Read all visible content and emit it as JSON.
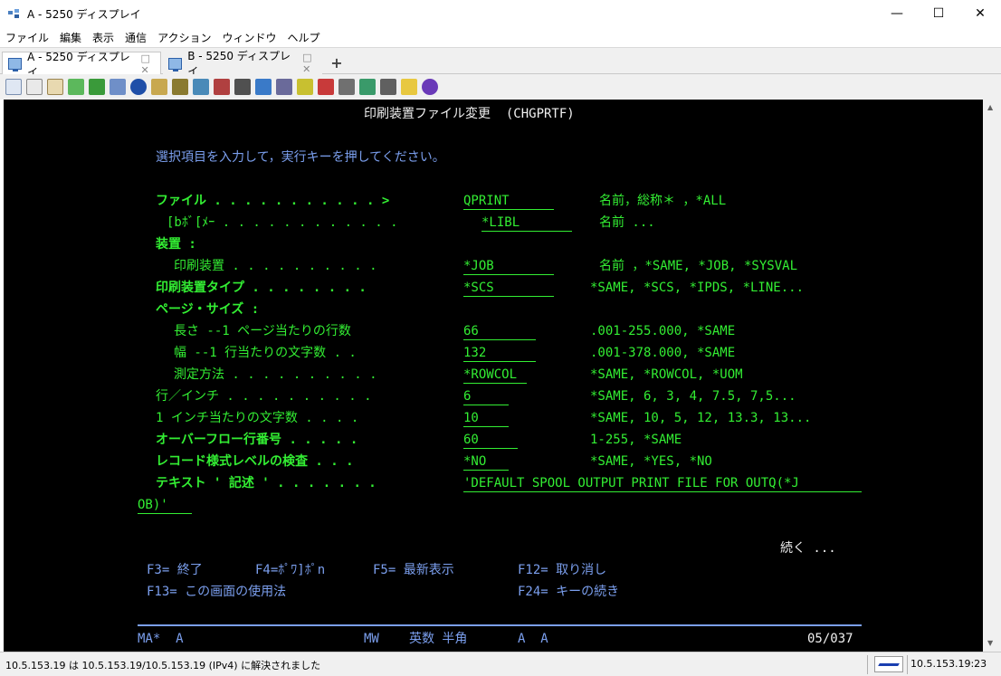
{
  "window": {
    "title": "A - 5250 ディスプレイ",
    "minimize": "—",
    "maximize": "☐",
    "close": "✕"
  },
  "menu": [
    "ファイル",
    "編集",
    "表示",
    "通信",
    "アクション",
    "ウィンドウ",
    "ヘルプ"
  ],
  "tabs": [
    {
      "label": "A - 5250 ディスプレイ",
      "active": true
    },
    {
      "label": "B - 5250 ディスプレイ",
      "active": false
    }
  ],
  "tab_controls": "□ ✕",
  "new_tab": "+",
  "toolbar_icons": [
    "copy-icon",
    "cut-icon",
    "paste-icon",
    "send-file-icon",
    "receive-file-icon",
    "macro-icon",
    "navigate-icon",
    "properties-icon",
    "print-screen-icon",
    "keypad-icon",
    "display-settings-icon",
    "session-icon",
    "color-map-icon",
    "grid-icon",
    "trace-icon",
    "disconnect-icon",
    "record-icon",
    "play-icon",
    "stop-icon",
    "notes-icon",
    "help-icon"
  ],
  "screen": {
    "title": "印刷装置ファイル変更  (CHGPRTF)",
    "instruction": "選択項目を入力して，実行キーを押してください。",
    "rows": [
      {
        "label": "ファイル . . . . . . . . . . . >",
        "value": "QPRINT",
        "hint": "名前，総称＊ ，*ALL",
        "bold": true
      },
      {
        "label": "[bﾎﾞ[ﾒｰ . . . . . . . . . . . .",
        "value": "*LIBL",
        "hint": "名前 ...",
        "bold": false
      },
      {
        "label": "装置 :",
        "value": "",
        "hint": "",
        "bold": true
      },
      {
        "label": "印刷装置 . . . . . . . . . .",
        "value": "*JOB",
        "hint": "名前 ，*SAME, *JOB, *SYSVAL",
        "bold": false
      },
      {
        "label": "印刷装置タイプ . . . . . . . .",
        "value": "*SCS",
        "hint": "*SAME, *SCS, *IPDS, *LINE...",
        "bold": true
      },
      {
        "label": "ページ・サイズ :",
        "value": "",
        "hint": "",
        "bold": true
      },
      {
        "label": "長さ --1 ページ当たりの行数",
        "value": "66",
        "hint": ".001-255.000, *SAME",
        "bold": false
      },
      {
        "label": "幅 --1 行当たりの文字数 . .",
        "value": "132",
        "hint": ".001-378.000, *SAME",
        "bold": false
      },
      {
        "label": "測定方法 . . . . . . . . . .",
        "value": "*ROWCOL",
        "hint": "*SAME, *ROWCOL, *UOM",
        "bold": false
      },
      {
        "label": "行／インチ . . . . . . . . . .",
        "value": "6",
        "hint": "*SAME, 6, 3, 4, 7.5, 7,5...",
        "bold": false
      },
      {
        "label": "1 インチ当たりの文字数 . . . .",
        "value": "10",
        "hint": "*SAME, 10, 5, 12, 13.3, 13...",
        "bold": false
      },
      {
        "label": "オーバーフロー行番号 . . . . .",
        "value": "60",
        "hint": "1-255, *SAME",
        "bold": true
      },
      {
        "label": "レコード様式レベルの検査 . . .",
        "value": "*NO",
        "hint": "*SAME, *YES, *NO",
        "bold": true
      },
      {
        "label": "テキスト ' 記述 ' . . . . . . .",
        "value": "'DEFAULT SPOOL OUTPUT PRINT FILE FOR OUTQ(*J",
        "hint": "",
        "bold": true
      }
    ],
    "text_continuation": "OB)'",
    "more": "続く ...",
    "fkeys_row1": [
      "F3= 終了",
      "F4=ﾎﾟﾜ]ﾎﾟn",
      "F5= 最新表示",
      "F12= 取り消し"
    ],
    "fkeys_row2": [
      "F13= この画面の使用法",
      "F24= キーの続き"
    ],
    "oia": {
      "left": "MA*  A",
      "mode": "MW",
      "input": "英数 半角",
      "flags": "A  A",
      "cursor": "05/037"
    }
  },
  "status": {
    "message": "10.5.153.19 は 10.5.153.19/10.5.153.19 (IPv4) に解決されました",
    "time": "10.5.153.19:23"
  }
}
